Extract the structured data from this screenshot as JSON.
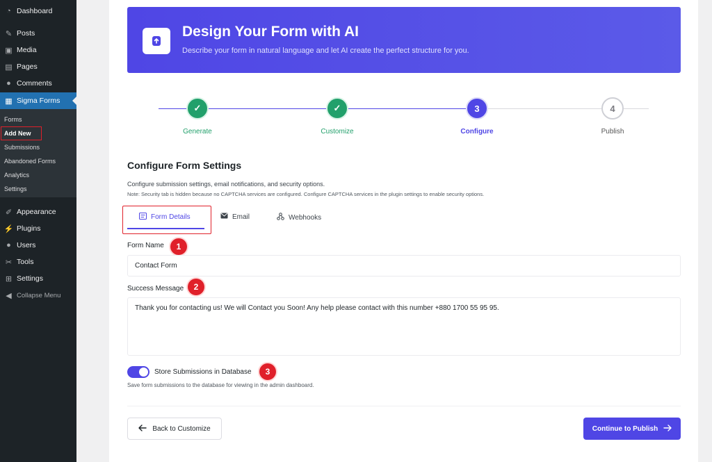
{
  "sidebar": {
    "items": [
      {
        "label": "Dashboard",
        "icon": "dashboard-icon"
      },
      {
        "label": "Posts",
        "icon": "pin-icon"
      },
      {
        "label": "Media",
        "icon": "media-icon"
      },
      {
        "label": "Pages",
        "icon": "pages-icon"
      },
      {
        "label": "Comments",
        "icon": "comment-icon"
      },
      {
        "label": "Sigma Forms",
        "icon": "form-icon"
      }
    ],
    "submenu": [
      "Forms",
      "Add New",
      "Submissions",
      "Abandoned Forms",
      "Analytics",
      "Settings"
    ],
    "lower_items": [
      {
        "label": "Appearance",
        "icon": "brush-icon"
      },
      {
        "label": "Plugins",
        "icon": "plugin-icon"
      },
      {
        "label": "Users",
        "icon": "user-icon"
      },
      {
        "label": "Tools",
        "icon": "wrench-icon"
      },
      {
        "label": "Settings",
        "icon": "settings-icon"
      }
    ],
    "collapse_label": "Collapse Menu"
  },
  "hero": {
    "title": "Design Your Form with AI",
    "subtitle": "Describe your form in natural language and let AI create the perfect structure for you."
  },
  "stepper": {
    "steps": [
      {
        "number": "✓",
        "label": "Generate",
        "state": "done"
      },
      {
        "number": "✓",
        "label": "Customize",
        "state": "done"
      },
      {
        "number": "3",
        "label": "Configure",
        "state": "current"
      },
      {
        "number": "4",
        "label": "Publish",
        "state": "pending"
      }
    ]
  },
  "settings": {
    "title": "Configure Form Settings",
    "description": "Configure submission settings, email notifications, and security options.",
    "note": "Note: Security tab is hidden because no CAPTCHA services are configured. Configure CAPTCHA services in the plugin settings to enable security options."
  },
  "tabs": [
    {
      "label": "Form Details"
    },
    {
      "label": "Email"
    },
    {
      "label": "Webhooks"
    }
  ],
  "form": {
    "form_name_label": "Form Name",
    "form_name_value": "Contact Form",
    "success_label": "Success Message",
    "success_value": "Thank you for contacting us! We will Contact you Soon! Any help please contact with this number +880 1700 55 95 95.",
    "store_label": "Store Submissions in Database",
    "store_help": "Save form submissions to the database for viewing in the admin dashboard.",
    "store_enabled": true
  },
  "badges": [
    "1",
    "2",
    "3"
  ],
  "buttons": {
    "back": "Back to Customize",
    "next": "Continue to Publish"
  },
  "colors": {
    "accent": "#4f46e5",
    "done": "#22a06b",
    "annotation": "#e0202a",
    "sidebar_bg": "#1d2327",
    "sidebar_active": "#2271b1"
  }
}
